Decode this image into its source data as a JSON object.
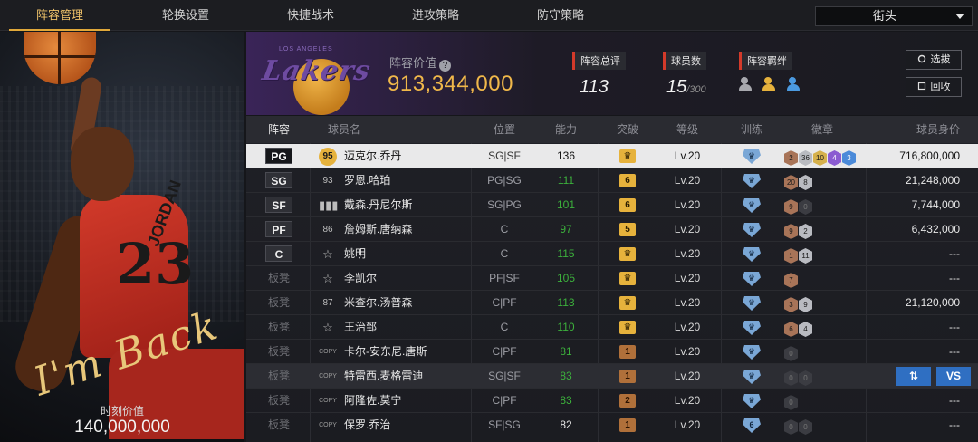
{
  "tabs": [
    {
      "label": "阵容管理",
      "active": true
    },
    {
      "label": "轮换设置",
      "active": false
    },
    {
      "label": "快捷战术",
      "active": false
    },
    {
      "label": "进攻策略",
      "active": false
    },
    {
      "label": "防守策略",
      "active": false
    }
  ],
  "mode_select": {
    "value": "街头"
  },
  "player_card": {
    "jersey_name": "JORDAN",
    "jersey_number": "23",
    "signature": "I'm Back",
    "value_label": "时刻价值",
    "value": "140,000,000"
  },
  "team": {
    "logo_text": "Lakers",
    "logo_small": "LOS ANGELES",
    "value_label": "阵容价值",
    "value_help": "?",
    "value": "913,344,000",
    "rating_label": "阵容总评",
    "rating": "113",
    "players_label": "球员数",
    "players_count": "15",
    "players_max": "/300",
    "bond_label": "阵容羁绊",
    "bond_icons": [
      "bond-gray",
      "bond-gold",
      "bond-blue"
    ],
    "pick_button": "选拔",
    "recycle_button": "回收"
  },
  "table": {
    "headers": [
      "阵容",
      "球员名",
      "位置",
      "能力",
      "突破",
      "等级",
      "训练",
      "徽章",
      "球员身价"
    ],
    "rows": [
      {
        "slot": "PG",
        "ovr": "95",
        "ovr_style": "gold",
        "name": "迈克尔.乔丹",
        "pos": "SG|SF",
        "ability": "136",
        "ability_color": "white",
        "breakthrough": "♛",
        "brk_style": "gold",
        "level": "Lv.20",
        "training": "♛",
        "badges": [
          {
            "v": "2",
            "c": "bronze"
          },
          {
            "v": "36",
            "c": "silver"
          },
          {
            "v": "10",
            "c": "gold"
          },
          {
            "v": "4",
            "c": "purple"
          },
          {
            "v": "3",
            "c": "blue"
          }
        ],
        "price": "716,800,000"
      },
      {
        "slot": "SG",
        "ovr": "93",
        "ovr_style": "plain",
        "name": "罗恩.哈珀",
        "pos": "PG|SG",
        "ability": "111",
        "ability_color": "green",
        "breakthrough": "6",
        "brk_style": "gold",
        "level": "Lv.20",
        "training": "♛",
        "badges": [
          {
            "v": "20",
            "c": "bronze"
          },
          {
            "v": "8",
            "c": "silver"
          }
        ],
        "price": "21,248,000"
      },
      {
        "slot": "SF",
        "ovr": "▮▮▮",
        "ovr_style": "bars",
        "name": "戴森.丹尼尔斯",
        "pos": "SG|PG",
        "ability": "101",
        "ability_color": "green",
        "breakthrough": "6",
        "brk_style": "gold",
        "level": "Lv.20",
        "training": "♛",
        "badges": [
          {
            "v": "9",
            "c": "bronze"
          },
          {
            "v": "0",
            "c": "dark"
          }
        ],
        "price": "7,744,000"
      },
      {
        "slot": "PF",
        "ovr": "86",
        "ovr_style": "plain",
        "name": "詹姆斯.唐纳森",
        "pos": "C",
        "ability": "97",
        "ability_color": "green",
        "breakthrough": "5",
        "brk_style": "gold",
        "level": "Lv.20",
        "training": "♛",
        "badges": [
          {
            "v": "9",
            "c": "bronze"
          },
          {
            "v": "2",
            "c": "silver"
          }
        ],
        "price": "6,432,000"
      },
      {
        "slot": "C",
        "ovr": "☆",
        "ovr_style": "star",
        "name": "姚明",
        "pos": "C",
        "ability": "115",
        "ability_color": "green",
        "breakthrough": "♛",
        "brk_style": "gold",
        "level": "Lv.20",
        "training": "♛",
        "badges": [
          {
            "v": "1",
            "c": "bronze"
          },
          {
            "v": "11",
            "c": "silver"
          }
        ],
        "price": "---"
      },
      {
        "slot": "板凳",
        "ovr": "☆",
        "ovr_style": "star",
        "name": "李凯尔",
        "pos": "PF|SF",
        "ability": "105",
        "ability_color": "green",
        "breakthrough": "♛",
        "brk_style": "gold",
        "level": "Lv.20",
        "training": "♛",
        "badges": [
          {
            "v": "7",
            "c": "bronze"
          }
        ],
        "price": "---"
      },
      {
        "slot": "板凳",
        "ovr": "87",
        "ovr_style": "plain",
        "name": "米查尔.汤普森",
        "pos": "C|PF",
        "ability": "113",
        "ability_color": "green",
        "breakthrough": "♛",
        "brk_style": "gold",
        "level": "Lv.20",
        "training": "♛",
        "badges": [
          {
            "v": "3",
            "c": "bronze"
          },
          {
            "v": "9",
            "c": "silver"
          }
        ],
        "price": "21,120,000"
      },
      {
        "slot": "板凳",
        "ovr": "☆",
        "ovr_style": "star",
        "name": "王治郅",
        "pos": "C",
        "ability": "110",
        "ability_color": "green",
        "breakthrough": "♛",
        "brk_style": "gold",
        "level": "Lv.20",
        "training": "♛",
        "badges": [
          {
            "v": "6",
            "c": "bronze"
          },
          {
            "v": "4",
            "c": "silver"
          }
        ],
        "price": "---"
      },
      {
        "slot": "板凳",
        "ovr": "COPY",
        "ovr_style": "copy",
        "name": "卡尔-安东尼.唐斯",
        "pos": "C|PF",
        "ability": "81",
        "ability_color": "green",
        "breakthrough": "1",
        "brk_style": "bronze",
        "level": "Lv.20",
        "training": "♛",
        "badges": [
          {
            "v": "0",
            "c": "dark"
          }
        ],
        "price": "---"
      },
      {
        "slot": "板凳",
        "ovr": "COPY",
        "ovr_style": "copy",
        "name": "特雷西.麦格雷迪",
        "pos": "SG|SF",
        "ability": "83",
        "ability_color": "green",
        "breakthrough": "1",
        "brk_style": "bronze",
        "level": "Lv.20",
        "training": "♛",
        "badges": [
          {
            "v": "0",
            "c": "dark"
          },
          {
            "v": "0",
            "c": "dark"
          }
        ],
        "price": "",
        "actions": {
          "swap": "⇅",
          "vs": "VS"
        }
      },
      {
        "slot": "板凳",
        "ovr": "COPY",
        "ovr_style": "copy",
        "name": "阿隆佐.莫宁",
        "pos": "C|PF",
        "ability": "83",
        "ability_color": "green",
        "breakthrough": "2",
        "brk_style": "bronze",
        "level": "Lv.20",
        "training": "♛",
        "badges": [
          {
            "v": "0",
            "c": "dark"
          }
        ],
        "price": "---"
      },
      {
        "slot": "板凳",
        "ovr": "COPY",
        "ovr_style": "copy",
        "name": "保罗.乔治",
        "pos": "SF|SG",
        "ability": "82",
        "ability_color": "white",
        "breakthrough": "1",
        "brk_style": "bronze",
        "level": "Lv.20",
        "training": "6",
        "badges": [
          {
            "v": "0",
            "c": "dark"
          },
          {
            "v": "0",
            "c": "dark"
          }
        ],
        "price": "---"
      }
    ]
  },
  "colors": {
    "accent": "#e0a83a",
    "team_value": "#f0b84a",
    "ability_green": "#3cb03c",
    "action_blue": "#2f6fc2"
  }
}
